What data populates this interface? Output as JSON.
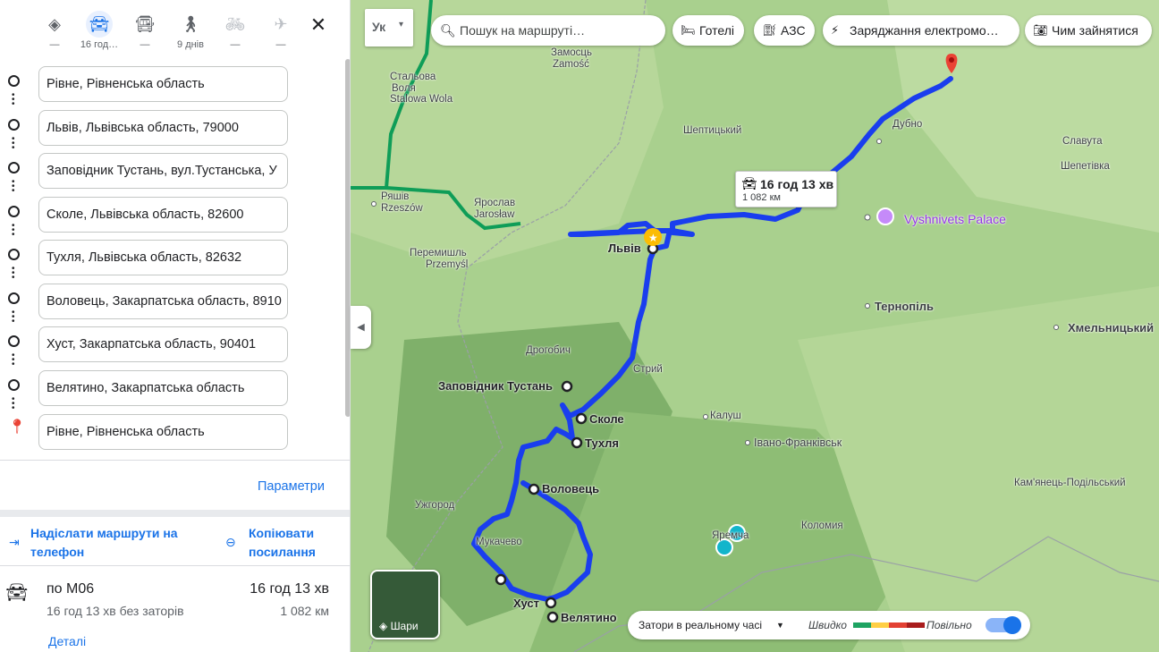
{
  "colors": {
    "accent": "#1a73e8",
    "route": "#1a3eee",
    "destination": "#ea4335",
    "map_bg": "#a9d08e"
  },
  "modes": [
    {
      "name": "best",
      "icon": "diamond-directions-icon",
      "label": "—"
    },
    {
      "name": "car",
      "icon": "car-icon",
      "label": "16 год…"
    },
    {
      "name": "transit",
      "icon": "bus-icon",
      "label": "—"
    },
    {
      "name": "walk",
      "icon": "walk-icon",
      "label": "9 днів"
    },
    {
      "name": "bike",
      "icon": "bike-icon",
      "label": "—"
    },
    {
      "name": "flight",
      "icon": "plane-icon",
      "label": "—"
    }
  ],
  "stops": [
    "Рівне, Рівненська область",
    "Львів, Львівська область, 79000",
    "Заповідник Тустань, вул.Тустанська, У",
    "Сколе, Львівська область, 82600",
    "Тухля, Львівська область, 82632",
    "Воловець, Закарпатська область, 8910",
    "Хуст, Закарпатська область, 90401",
    "Велятино, Закарпатська область",
    "Рівне, Рівненська область"
  ],
  "panel": {
    "params": "Параметри",
    "send_to_phone": "Надіслати маршрути на телефон",
    "copy_link": "Копіювати посилання",
    "route_via": "по М06",
    "route_sub": "16 год 13 хв без заторів",
    "route_time": "16 год 13 хв",
    "route_dist": "1 082 км",
    "details": "Деталі"
  },
  "map": {
    "lang_a": "Ук",
    "search_placeholder": "Пошук на маршруті…",
    "chips": [
      "Готелі",
      "АЗС",
      "Заряджання електромо…",
      "Чим зайнятися"
    ],
    "route_box_time": "16 год 13 хв",
    "route_box_dist": "1 082 км",
    "layers": "Шари",
    "traffic_select": "Затори в реальному часі",
    "fast": "Швидко",
    "slow": "Повільно",
    "cities": {
      "zamosc1": "Замосць",
      "zamosc2": "Zamość",
      "stal1": "Стальова",
      "stal2": "Воля",
      "stal3": "Stalowa Wola",
      "sheptytskyi": "Шептицький",
      "dubno": "Дубно",
      "slavuta": "Славута",
      "shepetivka": "Шепетівка",
      "rzeszow1": "Ряшів",
      "rzeszow2": "Rzeszów",
      "jaroslaw1": "Ярослав",
      "jaroslaw2": "Jarosław",
      "przemysl1": "Перемишль",
      "przemysl2": "Przemyśl",
      "lviv": "Львів",
      "vyshnivets": "Vyshnivets Palace",
      "ternopil": "Тернопіль",
      "khmelnytskyi": "Хмельницький",
      "drohobych": "Дрогобич",
      "stryi": "Стрий",
      "kalush": "Калуш",
      "ivano": "Івано-Франківськ",
      "kamianets": "Кам'янець-Подільський",
      "uzhhorod": "Ужгород",
      "mukachevo": "Мукачево",
      "yaremche": "Яремча",
      "kolomyia": "Коломия",
      "tustan": "Заповідник Тустань",
      "skole": "Сколе",
      "tukhlia": "Тухля",
      "volovets": "Воловець",
      "khust": "Хуст",
      "veliatyno": "Велятино"
    }
  }
}
